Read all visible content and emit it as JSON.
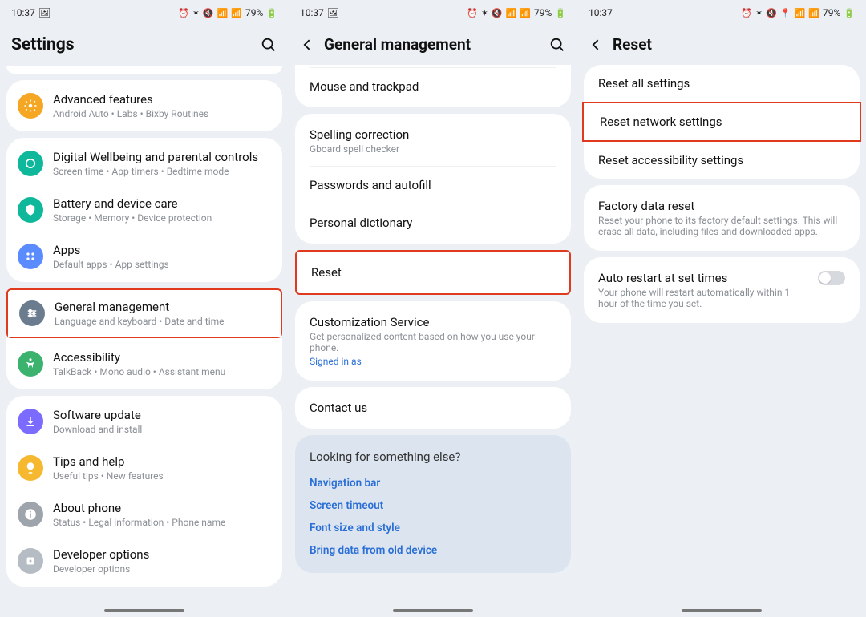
{
  "status": {
    "time": "10:37",
    "battery": "79%"
  },
  "panel1": {
    "title": "Settings",
    "items": [
      {
        "label": "Advanced features",
        "sub": "Android Auto  •  Labs  •  Bixby Routines"
      },
      {
        "label": "Digital Wellbeing and parental controls",
        "sub": "Screen time  •  App timers  •  Bedtime mode"
      },
      {
        "label": "Battery and device care",
        "sub": "Storage  •  Memory  •  Device protection"
      },
      {
        "label": "Apps",
        "sub": "Default apps  •  App settings"
      },
      {
        "label": "General management",
        "sub": "Language and keyboard  •  Date and time"
      },
      {
        "label": "Accessibility",
        "sub": "TalkBack  •  Mono audio  •  Assistant menu"
      },
      {
        "label": "Software update",
        "sub": "Download and install"
      },
      {
        "label": "Tips and help",
        "sub": "Useful tips  •  New features"
      },
      {
        "label": "About phone",
        "sub": "Status  •  Legal information  •  Phone name"
      },
      {
        "label": "Developer options",
        "sub": "Developer options"
      }
    ]
  },
  "panel2": {
    "title": "General management",
    "group1": [
      {
        "label": "Mouse and trackpad",
        "sub": ""
      }
    ],
    "group2": [
      {
        "label": "Spelling correction",
        "sub": "Gboard spell checker"
      },
      {
        "label": "Passwords and autofill",
        "sub": ""
      },
      {
        "label": "Personal dictionary",
        "sub": ""
      }
    ],
    "reset": {
      "label": "Reset"
    },
    "group3": [
      {
        "label": "Customization Service",
        "sub": "Get personalized content based on how you use your phone.",
        "link": "Signed in as"
      }
    ],
    "contact": {
      "label": "Contact us"
    },
    "look": {
      "q": "Looking for something else?",
      "links": [
        "Navigation bar",
        "Screen timeout",
        "Font size and style",
        "Bring data from old device"
      ]
    }
  },
  "panel3": {
    "title": "Reset",
    "group1": [
      {
        "label": "Reset all settings"
      },
      {
        "label": "Reset network settings"
      },
      {
        "label": "Reset accessibility settings"
      }
    ],
    "factory": {
      "label": "Factory data reset",
      "sub": "Reset your phone to its factory default settings. This will erase all data, including files and downloaded apps."
    },
    "auto": {
      "label": "Auto restart at set times",
      "sub": "Your phone will restart automatically within 1 hour of the time you set."
    }
  }
}
